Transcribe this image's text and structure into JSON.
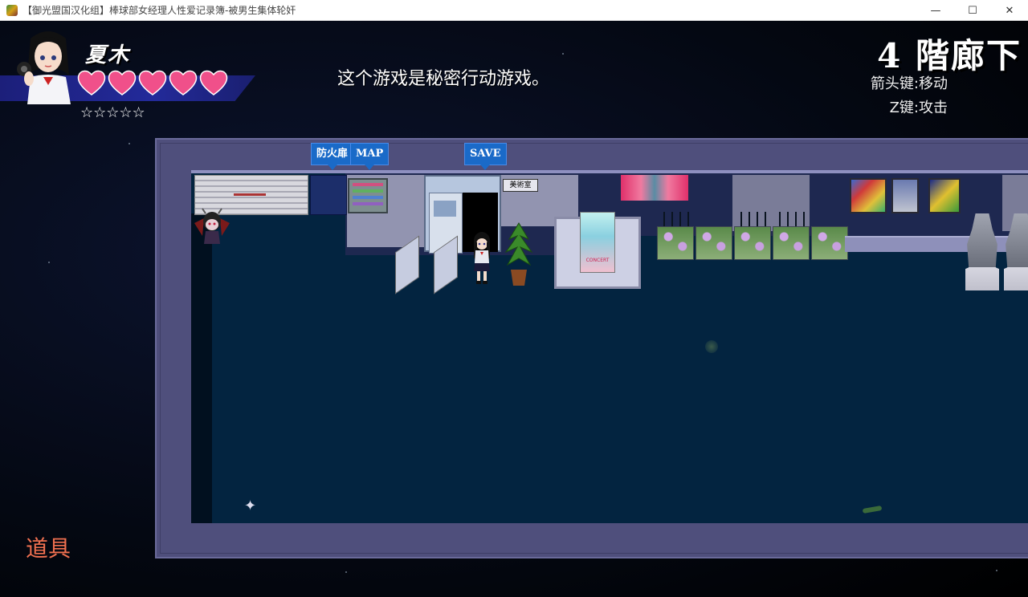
{
  "window": {
    "title": "【御光盟国汉化组】棒球部女经理人性爱记录簿-被男生集体轮奸",
    "minimize_symbol": "—",
    "maximize_symbol": "☐",
    "close_symbol": "✕"
  },
  "hud": {
    "character_name": "夏木",
    "hearts": 5,
    "rating_stars": "☆☆☆☆☆",
    "message": "这个游戏是秘密行动游戏。",
    "location": "4 階廊下",
    "controls": [
      "箭头键:移动",
      "Z键:攻击"
    ],
    "items_label": "道具"
  },
  "map": {
    "tags": [
      "防火扉",
      "MAP",
      "SAVE"
    ],
    "room_sign": "美術室",
    "poster_text": "CONCERT"
  },
  "colors": {
    "heart": "#f0508a",
    "hud_band": "#232a9a",
    "items_label": "#f07050",
    "tag_bg": "#1a6ac8",
    "floor": "#032440"
  }
}
